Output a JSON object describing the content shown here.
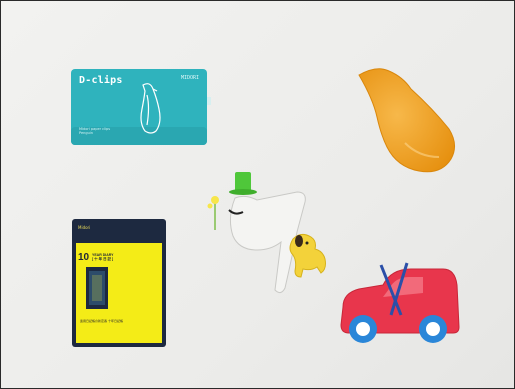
{
  "clips_card": {
    "title": "D-clips",
    "brand": "MIDORI",
    "subtitle": "Midori paper clips",
    "subtitle2": "Penguin"
  },
  "diary": {
    "top_text": "Midori",
    "number": "10",
    "name_line1": "YEAR DIARY",
    "name_line2": "[ 十 年 日 記 ]",
    "bottom_text": "連用日記帳の新定番 十年日記帳"
  },
  "colors": {
    "background": "#ededeb",
    "clips_teal": "#2fb3bd",
    "diary_navy": "#1d2940",
    "diary_yellow": "#f4ec17",
    "pear_orange": "#f0a11e",
    "car_red": "#e8364c",
    "car_wheel_blue": "#2a86d8",
    "hat_green": "#4fc73a",
    "dog_yellow": "#f3d23a"
  },
  "icons": {
    "clips_card": "penguin-outline-icon",
    "pear": "pear-shape-icon",
    "gentleman": "gentleman-with-top-hat-icon",
    "dog": "yellow-dog-icon",
    "car": "red-car-icon"
  }
}
